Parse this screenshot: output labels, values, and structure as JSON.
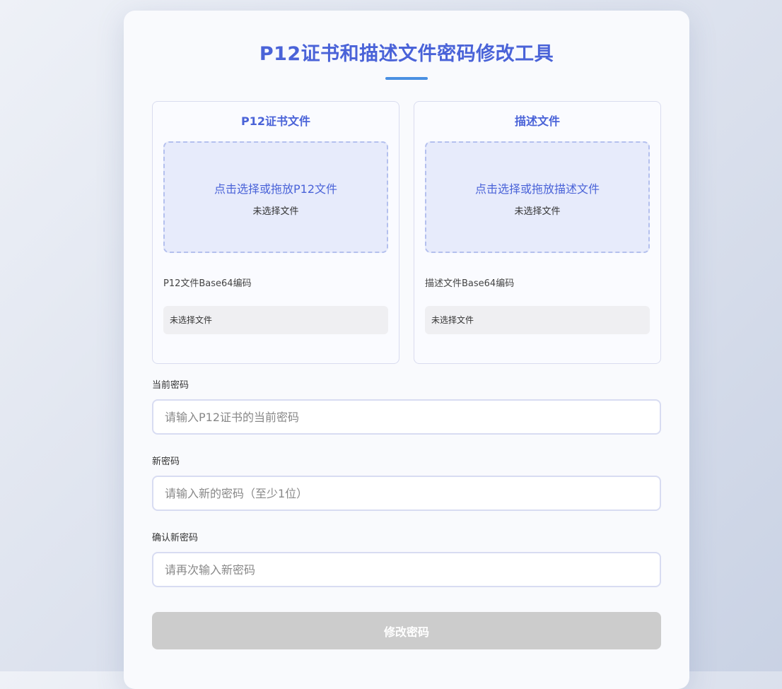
{
  "title": "P12证书和描述文件密码修改工具",
  "p12_panel": {
    "title": "P12证书文件",
    "drop_prompt": "点击选择或拖放P12文件",
    "file_status": "未选择文件",
    "base64_label": "P12文件Base64编码",
    "base64_value": "未选择文件"
  },
  "profile_panel": {
    "title": "描述文件",
    "drop_prompt": "点击选择或拖放描述文件",
    "file_status": "未选择文件",
    "base64_label": "描述文件Base64编码",
    "base64_value": "未选择文件"
  },
  "current_password": {
    "label": "当前密码",
    "placeholder": "请输入P12证书的当前密码",
    "value": ""
  },
  "new_password": {
    "label": "新密码",
    "placeholder": "请输入新的密码（至少1位）",
    "value": ""
  },
  "confirm_password": {
    "label": "确认新密码",
    "placeholder": "请再次输入新密码",
    "value": ""
  },
  "submit_label": "修改密码",
  "colors": {
    "accent": "#4a63d8",
    "title_underline": "#4a90e2",
    "dropzone_bg": "#e7ebfb",
    "disabled_button": "#cccccc"
  }
}
